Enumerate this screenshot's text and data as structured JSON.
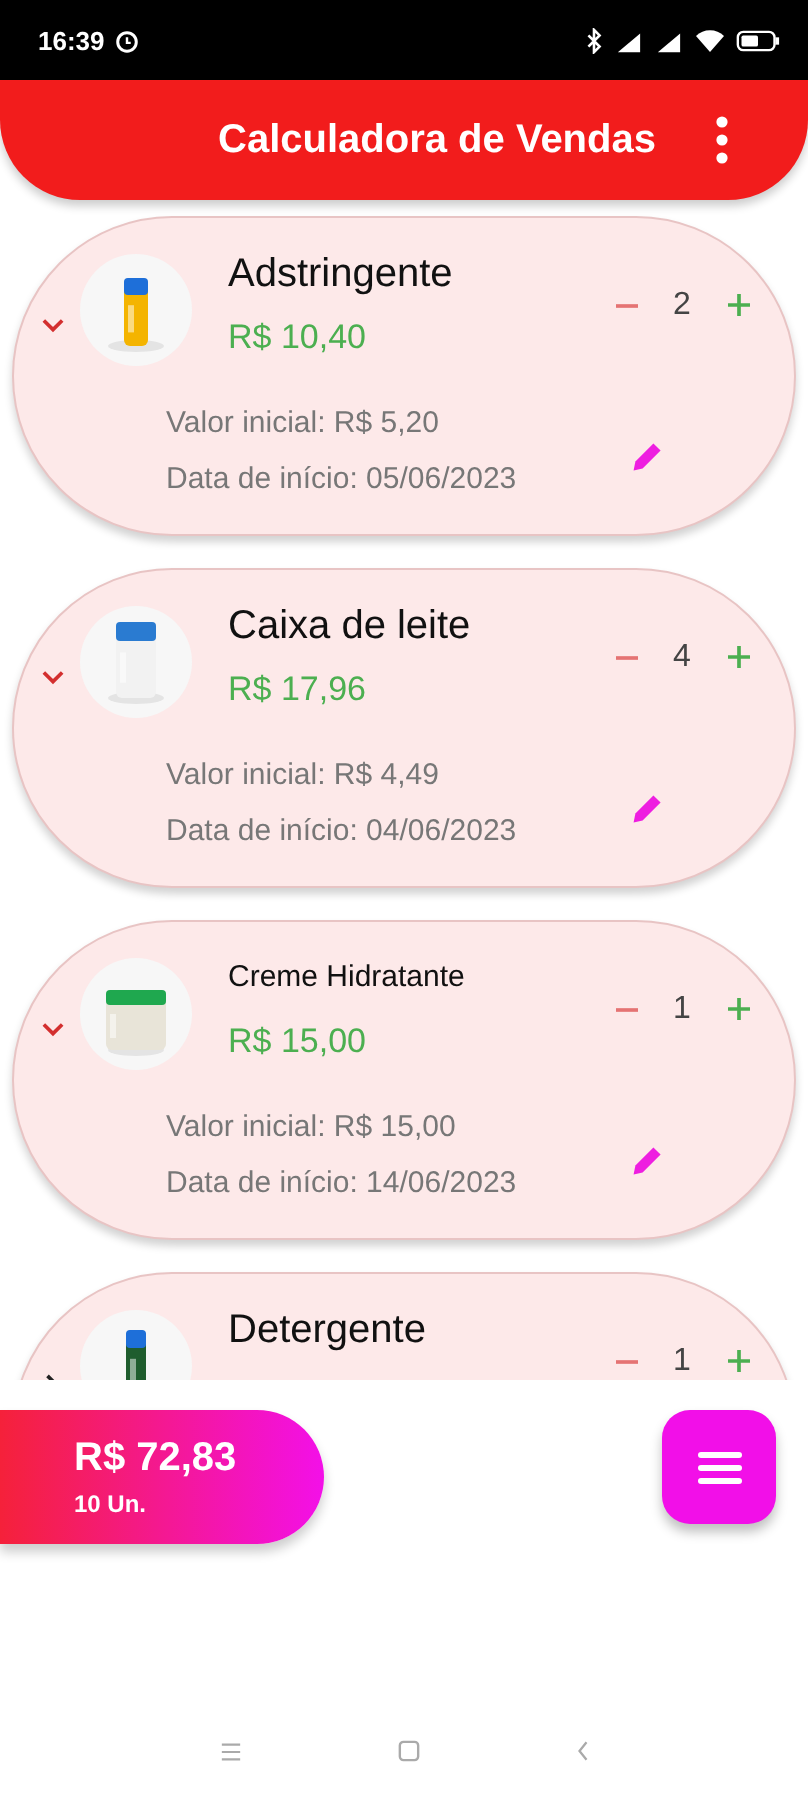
{
  "status_bar": {
    "time": "16:39"
  },
  "app_bar": {
    "title": "Calculadora de Vendas"
  },
  "products": [
    {
      "name": "Adstringente",
      "price": "R$ 10,40",
      "quantity": "2",
      "expanded": true,
      "initial_value": "Valor inicial: R$ 5,20",
      "start_date": "Data de início: 05/06/2023"
    },
    {
      "name": "Caixa de leite",
      "price": "R$ 17,96",
      "quantity": "4",
      "expanded": true,
      "initial_value": "Valor inicial: R$ 4,49",
      "start_date": "Data de início: 04/06/2023"
    },
    {
      "name": "Creme Hidratante",
      "price": "R$ 15,00",
      "quantity": "1",
      "expanded": true,
      "initial_value": "Valor inicial: R$ 15,00",
      "start_date": "Data de início: 14/06/2023"
    },
    {
      "name": "Detergente",
      "quantity": "1",
      "expanded": false
    }
  ],
  "total": {
    "amount": "R$ 72,83",
    "units": "10 Un."
  }
}
